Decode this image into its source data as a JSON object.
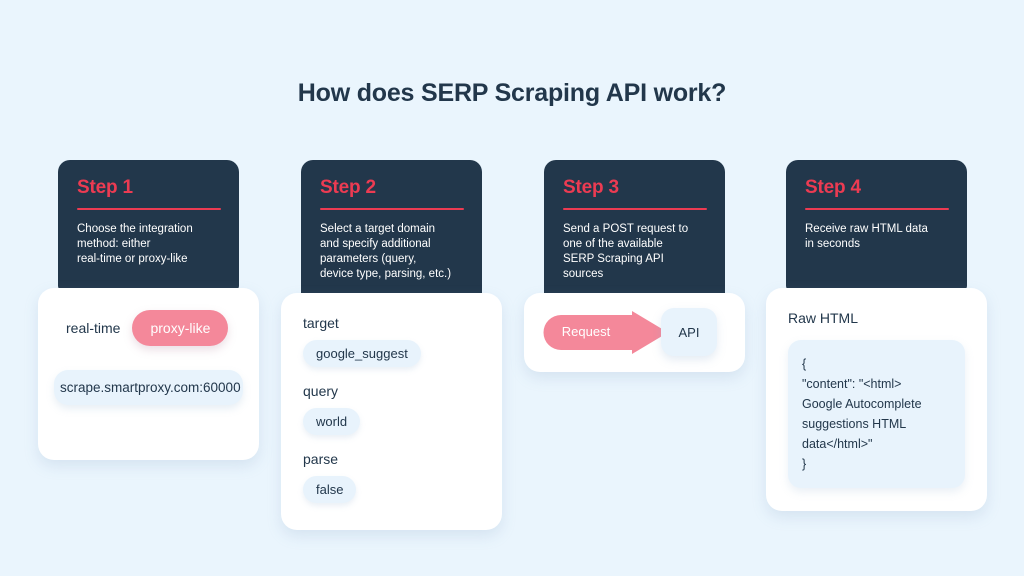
{
  "header": {
    "title": "How does SERP Scraping API work?"
  },
  "colors": {
    "background": "#eaf5fd",
    "card_dark": "#22374b",
    "accent_red": "#ec3b52",
    "accent_pink": "#f4889a",
    "chip_blue": "#e8f3fc",
    "panel_white": "#ffffff"
  },
  "steps": [
    {
      "label": "Step 1",
      "description": "Choose the integration\nmethod: either\nreal-time or proxy-like",
      "options": {
        "plain": "real-time",
        "selected": "proxy-like"
      },
      "endpoint": "scrape.smartproxy.com:60000"
    },
    {
      "label": "Step 2",
      "description": "Select a target domain\nand specify additional\nparameters (query,\ndevice type, parsing, etc.)",
      "fields": [
        {
          "name": "target",
          "value": "google_suggest"
        },
        {
          "name": "query",
          "value": "world"
        },
        {
          "name": "parse",
          "value": "false"
        }
      ]
    },
    {
      "label": "Step 3",
      "description": "Send a POST request to\none of the available\nSERP Scraping API\nsources",
      "arrow_label": "Request",
      "target_label": "API"
    },
    {
      "label": "Step 4",
      "description": "Receive raw HTML data\nin seconds",
      "section_label": "Raw HTML",
      "code": "{\n    \"content\": \"<html>\nGoogle Autocomplete\nsuggestions HTML\ndata</html>\"\n}"
    }
  ]
}
